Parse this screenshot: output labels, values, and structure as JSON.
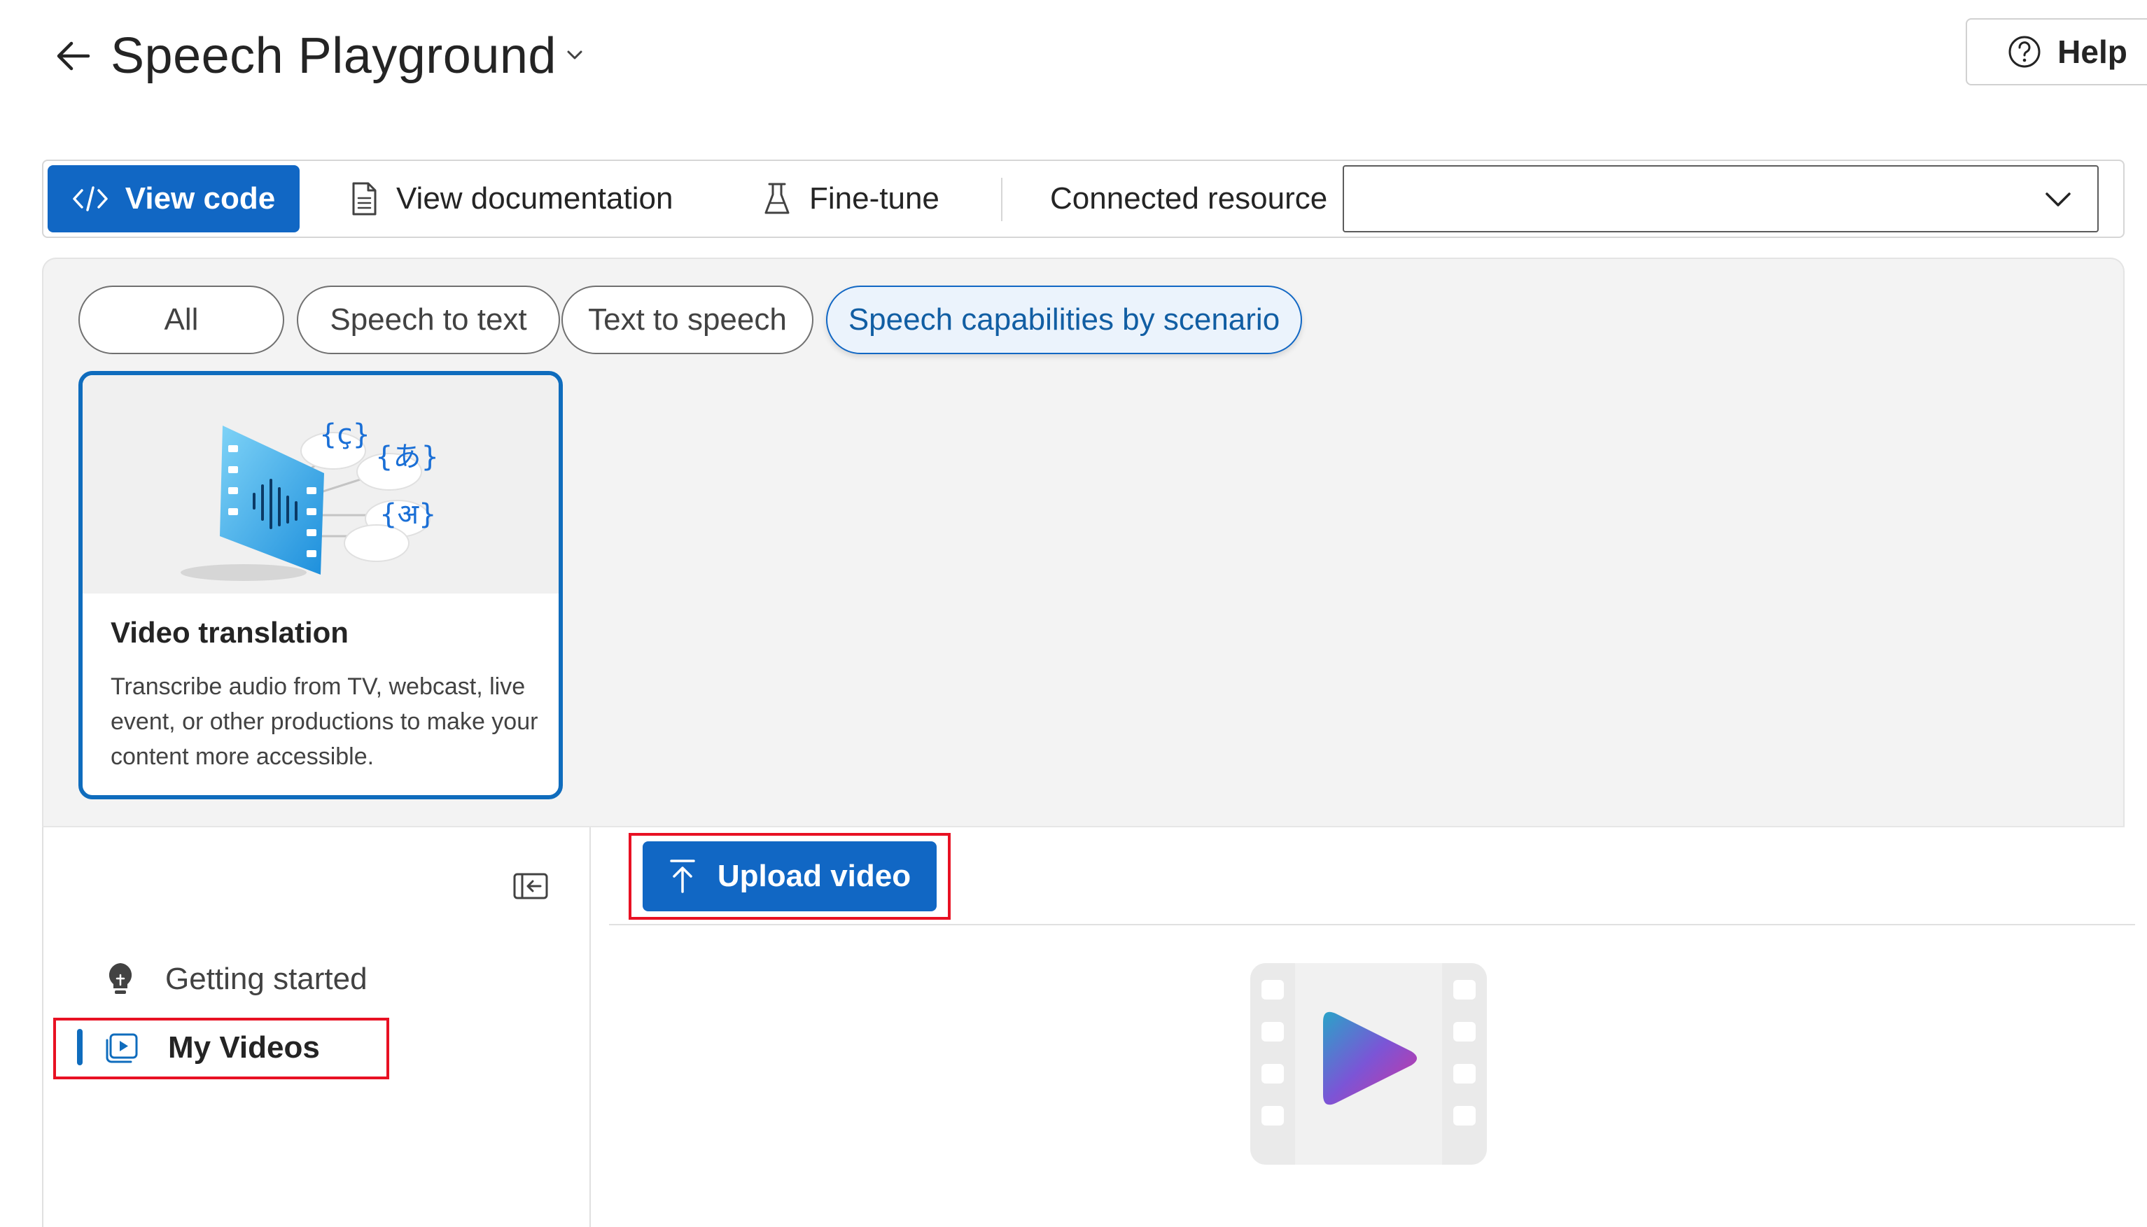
{
  "header": {
    "title": "Speech Playground",
    "help_label": "Help"
  },
  "toolbar": {
    "view_code_label": "View code",
    "view_documentation_label": "View documentation",
    "fine_tune_label": "Fine-tune",
    "connected_resource_label": "Connected resource",
    "connected_resource_value": ""
  },
  "filters": {
    "pills": [
      {
        "label": "All",
        "selected": false
      },
      {
        "label": "Speech to text",
        "selected": false
      },
      {
        "label": "Text to speech",
        "selected": false
      },
      {
        "label": "Speech capabilities by scenario",
        "selected": true
      }
    ]
  },
  "card": {
    "title": "Video translation",
    "description": "Transcribe audio from TV, webcast, live event, or other productions to make your content more accessible.",
    "glyphs": [
      "{ç}",
      "{あ}",
      "{अ}"
    ]
  },
  "sidebar": {
    "items": [
      {
        "label": "Getting started",
        "icon": "lightbulb-icon",
        "active": false
      },
      {
        "label": "My Videos",
        "icon": "video-icon",
        "active": true
      }
    ]
  },
  "main": {
    "upload_label": "Upload video"
  },
  "colors": {
    "accent": "#1167c4",
    "highlight": "#e81123"
  }
}
